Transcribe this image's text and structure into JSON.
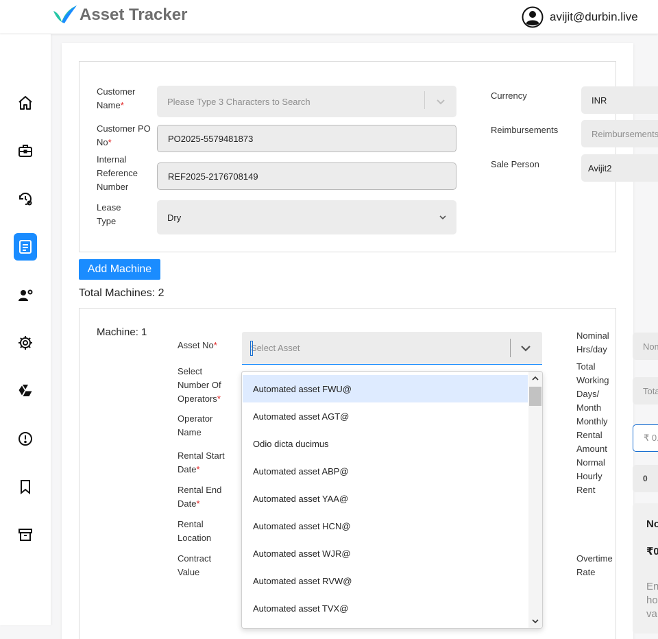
{
  "header": {
    "title": "Asset Tracker",
    "user_email": "avijit@durbin.live"
  },
  "sidebar": {
    "items": [
      {
        "icon": "home-icon"
      },
      {
        "icon": "briefcase-icon"
      },
      {
        "icon": "history-settings-icon"
      },
      {
        "icon": "document-icon",
        "active": true
      },
      {
        "icon": "operator-settings-icon"
      },
      {
        "icon": "gear-icon"
      },
      {
        "icon": "drive-icon"
      },
      {
        "icon": "alert-circle-icon"
      },
      {
        "icon": "bookmark-icon"
      },
      {
        "icon": "archive-icon"
      }
    ],
    "active_color": "#1a8cff"
  },
  "form": {
    "customer_name_label": "Customer Name",
    "customer_name_placeholder": "Please Type 3 Characters to Search",
    "customer_po_label": "Customer PO No",
    "customer_po_value": "PO2025-5579481873",
    "internal_ref_label": "Internal Reference Number",
    "internal_ref_value": "REF2025-2176708149",
    "lease_type_label": "Lease Type",
    "lease_type_value": "Dry",
    "currency_label": "Currency",
    "currency_value": "INR",
    "reimbursements_label": "Reimbursements",
    "reimbursements_placeholder": "Reimbursements",
    "sale_person_label": "Sale Person",
    "sale_person_value": "Avijit2",
    "required_mark": "*"
  },
  "machines": {
    "add_button": "Add Machine",
    "total_label": "Total Machines: 2",
    "machine_title": "Machine: 1",
    "asset_no_label": "Asset No",
    "asset_placeholder": "Select Asset",
    "operators_label": "Select Number Of Operators",
    "operator_name_label": "Operator Name",
    "rental_start_label": "Rental Start Date",
    "rental_end_label": "Rental End Date",
    "rental_location_label": "Rental Location",
    "contract_value_label": "Contract Value",
    "nominal_hrs_label": "Nominal Hrs/day",
    "nominal_hrs_placeholder": "Nom",
    "total_days_label": "Total Working Days/ Month",
    "total_days_placeholder": "Tota",
    "monthly_rental_label": "Monthly Rental Amount",
    "monthly_rental_placeholder": "₹ 0.",
    "normal_hourly_label": "Normal Hourly Rent",
    "normal_hourly_value": "0",
    "overtime_label": "Overtime Rate",
    "info_card": {
      "title": "No",
      "amount": "₹0",
      "text": "En ho va"
    }
  },
  "dropdown": {
    "options": [
      "Automated asset FWU@",
      "Automated asset AGT@",
      "Odio dicta ducimus",
      "Automated asset ABP@",
      "Automated asset YAA@",
      "Automated asset HCN@",
      "Automated asset WJR@",
      "Automated asset RVW@",
      "Automated asset TVX@"
    ],
    "highlighted_index": 0
  }
}
